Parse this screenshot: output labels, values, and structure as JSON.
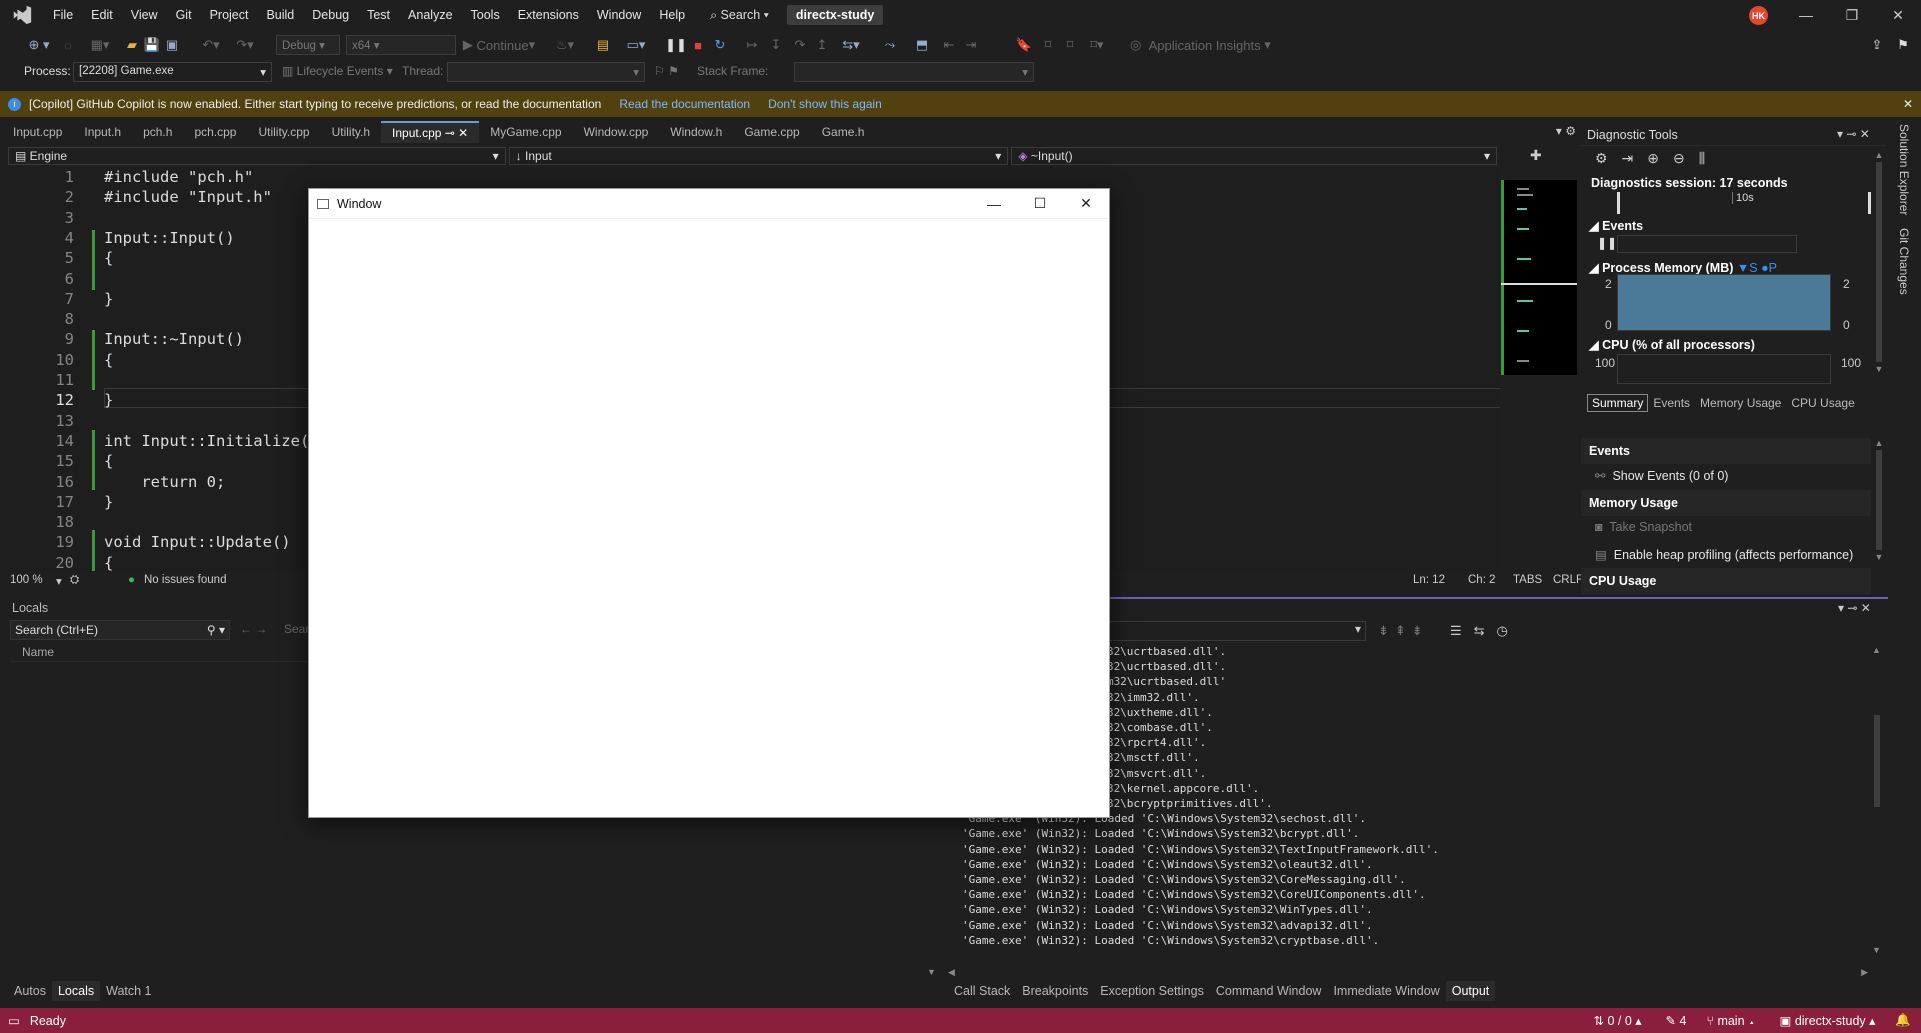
{
  "menubar": {
    "logo": "VS",
    "items": [
      "File",
      "Edit",
      "View",
      "Git",
      "Project",
      "Build",
      "Debug",
      "Test",
      "Analyze",
      "Tools",
      "Extensions",
      "Window",
      "Help"
    ],
    "search_label": "Search",
    "solution_title": "directx-study",
    "avatar_initials": "HK"
  },
  "toolbar": {
    "config": "Debug",
    "platform": "x64",
    "continue_label": "Continue",
    "app_insights": "Application Insights"
  },
  "toolbar2": {
    "process_label": "Process:",
    "process_value": "[22208] Game.exe",
    "lifecycle_label": "Lifecycle Events",
    "thread_label": "Thread:",
    "stack_frame_label": "Stack Frame:"
  },
  "infobar": {
    "message": "[Copilot] GitHub Copilot is now enabled. Either start typing to receive predictions, or read the documentation",
    "link1": "Read the documentation",
    "link2": "Don't show this again"
  },
  "editor_tabs": [
    "Input.cpp",
    "Input.h",
    "pch.h",
    "pch.cpp",
    "Utility.cpp",
    "Utility.h",
    "Input.cpp",
    "MyGame.cpp",
    "Window.cpp",
    "Window.h",
    "Game.cpp",
    "Game.h"
  ],
  "editor_tabs_active_index": 6,
  "navbar": {
    "project": "Engine",
    "scope": "Input",
    "member": "~Input()"
  },
  "code": {
    "line_numbers": [
      "1",
      "2",
      "3",
      "4",
      "5",
      "6",
      "7",
      "8",
      "9",
      "10",
      "11",
      "12",
      "13",
      "14",
      "15",
      "16",
      "17",
      "18",
      "19",
      "20"
    ],
    "current_line": 12,
    "lines": [
      "#include \"pch.h\"",
      "#include \"Input.h\"",
      "",
      "Input::Input()",
      "{",
      "",
      "}",
      "",
      "Input::~Input()",
      "{",
      "",
      "}",
      "",
      "int Input::Initialize()",
      "{",
      "    return 0;",
      "}",
      "",
      "void Input::Update()",
      "{"
    ]
  },
  "editor_status": {
    "zoom": "100 %",
    "issues": "No issues found",
    "ln": "Ln: 12",
    "ch": "Ch: 2",
    "tabs": "TABS",
    "eol": "CRLF"
  },
  "diagnostics": {
    "title": "Diagnostic Tools",
    "session": "Diagnostics session: 17 seconds",
    "timeline_label": "10s",
    "events_section": "Events",
    "memory_section": "Process Memory (MB)",
    "memory_legend": [
      "S",
      "P"
    ],
    "memory_max": "2",
    "memory_min": "0",
    "cpu_section": "CPU (% of all processors)",
    "cpu_max": "100",
    "tabs": [
      "Summary",
      "Events",
      "Memory Usage",
      "CPU Usage"
    ],
    "summary_events_heading": "Events",
    "show_events": "Show Events (0 of 0)",
    "memory_usage_heading": "Memory Usage",
    "take_snapshot": "Take Snapshot",
    "heap_profiling": "Enable heap profiling (affects performance)",
    "cpu_usage_heading": "CPU Usage"
  },
  "side_tabs": [
    "Solution Explorer",
    "Git Changes"
  ],
  "locals": {
    "title": "Locals",
    "search_placeholder": "Search (Ctrl+E)",
    "search_depth_label": "Sear",
    "column_name": "Name"
  },
  "output_lines_top": [
    "oaded 'C:\\Windows\\System32\\ucrtbased.dll'.",
    "oaded 'C:\\Windows\\System32\\ucrtbased.dll'.",
    "Loaded 'C:\\Windows\\System32\\ucrtbased.dll'",
    "oaded 'C:\\Windows\\System32\\imm32.dll'.",
    "oaded 'C:\\Windows\\System32\\uxtheme.dll'.",
    "oaded 'C:\\Windows\\System32\\combase.dll'.",
    "oaded 'C:\\Windows\\System32\\rpcrt4.dll'.",
    "oaded 'C:\\Windows\\System32\\msctf.dll'.",
    "oaded 'C:\\Windows\\System32\\msvcrt.dll'.",
    "oaded 'C:\\Windows\\System32\\kernel.appcore.dll'.",
    "oaded 'C:\\Windows\\System32\\bcryptprimitives.dll'."
  ],
  "output_lines": [
    "'Game.exe' (Win32): Loaded 'C:\\Windows\\System32\\sechost.dll'.",
    "'Game.exe' (Win32): Loaded 'C:\\Windows\\System32\\bcrypt.dll'.",
    "'Game.exe' (Win32): Loaded 'C:\\Windows\\System32\\TextInputFramework.dll'.",
    "'Game.exe' (Win32): Loaded 'C:\\Windows\\System32\\oleaut32.dll'.",
    "'Game.exe' (Win32): Loaded 'C:\\Windows\\System32\\CoreMessaging.dll'.",
    "'Game.exe' (Win32): Loaded 'C:\\Windows\\System32\\CoreUIComponents.dll'.",
    "'Game.exe' (Win32): Loaded 'C:\\Windows\\System32\\WinTypes.dll'.",
    "'Game.exe' (Win32): Loaded 'C:\\Windows\\System32\\advapi32.dll'.",
    "'Game.exe' (Win32): Loaded 'C:\\Windows\\System32\\cryptbase.dll'."
  ],
  "bottom_tabs_left": [
    "Autos",
    "Locals",
    "Watch 1"
  ],
  "bottom_tabs_right": [
    "Call Stack",
    "Breakpoints",
    "Exception Settings",
    "Command Window",
    "Immediate Window",
    "Output"
  ],
  "statusbar": {
    "ready": "Ready",
    "sync": "0 / 0",
    "edits": "4",
    "branch": "main",
    "repo": "directx-study"
  },
  "popup_window": {
    "title": "Window"
  },
  "colors": {
    "statusbar": "#8a1f3b",
    "infobar": "#50410e",
    "accent": "#6b9bd4"
  }
}
